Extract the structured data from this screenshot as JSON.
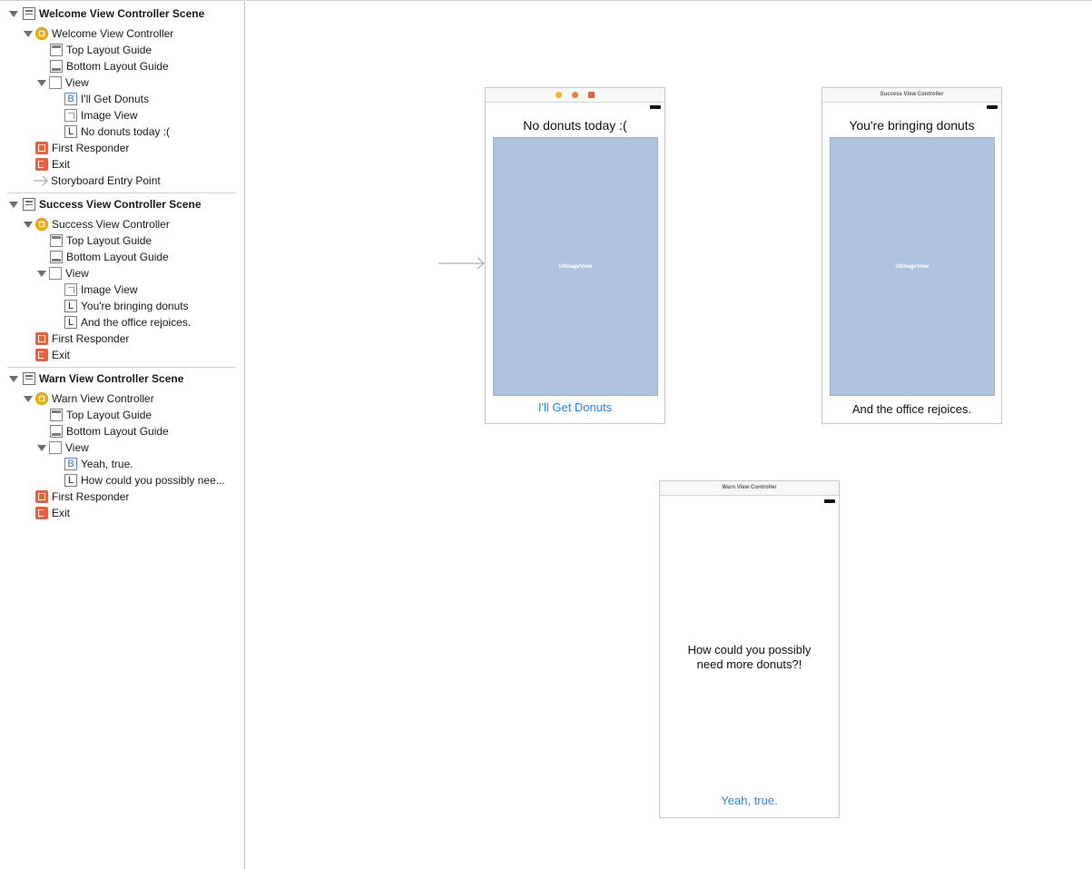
{
  "outline": {
    "scenes": [
      {
        "title": "Welcome View Controller Scene",
        "controller": "Welcome View Controller",
        "top_guide": "Top Layout Guide",
        "bottom_guide": "Bottom Layout Guide",
        "view": "View",
        "children": [
          {
            "type": "B",
            "label": "I'll Get Donuts"
          },
          {
            "type": "image",
            "label": "Image View"
          },
          {
            "type": "L",
            "label": "No donuts today :("
          }
        ],
        "first_responder": "First Responder",
        "exit": "Exit",
        "entry_point": "Storyboard Entry Point"
      },
      {
        "title": "Success View Controller Scene",
        "controller": "Success View Controller",
        "top_guide": "Top Layout Guide",
        "bottom_guide": "Bottom Layout Guide",
        "view": "View",
        "children": [
          {
            "type": "image",
            "label": "Image View"
          },
          {
            "type": "L",
            "label": "You're bringing donuts"
          },
          {
            "type": "L",
            "label": "And the office rejoices."
          }
        ],
        "first_responder": "First Responder",
        "exit": "Exit"
      },
      {
        "title": "Warn View Controller Scene",
        "controller": "Warn View Controller",
        "top_guide": "Top Layout Guide",
        "bottom_guide": "Bottom Layout Guide",
        "view": "View",
        "children": [
          {
            "type": "B",
            "label": "Yeah, true."
          },
          {
            "type": "L",
            "label": "How could you possibly nee..."
          }
        ],
        "first_responder": "First Responder",
        "exit": "Exit"
      }
    ]
  },
  "canvas": {
    "welcome": {
      "dock_colors": [
        "#f2b41f",
        "#ef7d3a",
        "#e8603c"
      ],
      "label": "No donuts today :(",
      "image_placeholder": "UIImageView",
      "button": "I'll Get Donuts"
    },
    "success": {
      "title": "Success View Controller",
      "label_top": "You're bringing donuts",
      "image_placeholder": "UIImageView",
      "label_bottom": "And the office rejoices."
    },
    "warn": {
      "title": "Warn View Controller",
      "message_line1": "How could you possibly",
      "message_line2": "need more donuts?!",
      "button": "Yeah, true."
    }
  },
  "colors": {
    "accent_blue": "#2b86e8",
    "image_view": "#aec3e0"
  }
}
